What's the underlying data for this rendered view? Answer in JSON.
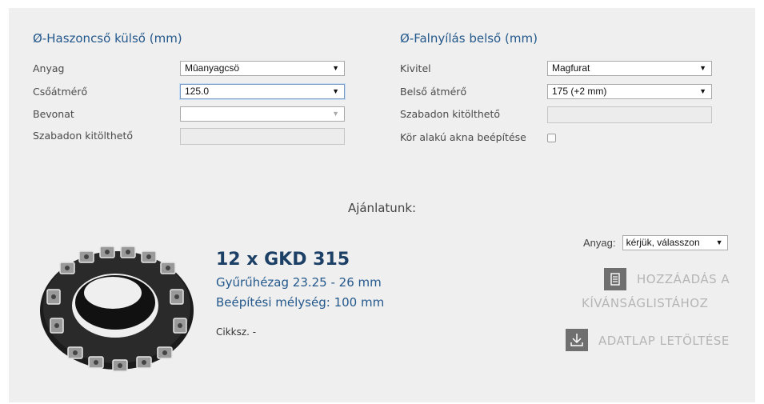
{
  "left_section": {
    "title": "Ø-Haszoncső külső (mm)",
    "material_label": "Anyag",
    "material_value": "Mûanyagcsö",
    "diameter_label": "Csőátmérő",
    "diameter_value": "125.0",
    "coating_label": "Bevonat",
    "coating_value": "",
    "free_label": "Szabadon kitölthető"
  },
  "right_section": {
    "title": "Ø-Falnyílás belső (mm)",
    "design_label": "Kivitel",
    "design_value": "Magfurat",
    "inner_diameter_label": "Belső átmérő",
    "inner_diameter_value": "175 (+2 mm)",
    "free_label": "Szabadon kitölthető",
    "round_shaft_label": "Kör alakú akna beépítése",
    "round_shaft_checked": false
  },
  "recommendation": {
    "heading": "Ajánlatunk:",
    "product_title": "12 x GKD 315",
    "gap": "Gyűrűhézag 23.25 - 26 mm",
    "depth": "Beépítési mélység: 100 mm",
    "sku": "Cikksz. -",
    "material_label": "Anyag:",
    "material_value": "kérjük, válasszon",
    "wishlist_line1": "HOZZÁADÁS A",
    "wishlist_line2": "KÍVÁNSÁGLISTÁHOZ",
    "download_label": "ADATLAP LETÖLTÉSE"
  },
  "icons": {
    "dropdown": "triangle-down",
    "wishlist": "list-icon",
    "download": "download-icon"
  },
  "colors": {
    "accent": "#23588c",
    "title_dark": "#1c3f66",
    "panel_bg": "#efefef",
    "button_text": "#b5b5b5",
    "icon_bg": "#6f6f6f"
  }
}
